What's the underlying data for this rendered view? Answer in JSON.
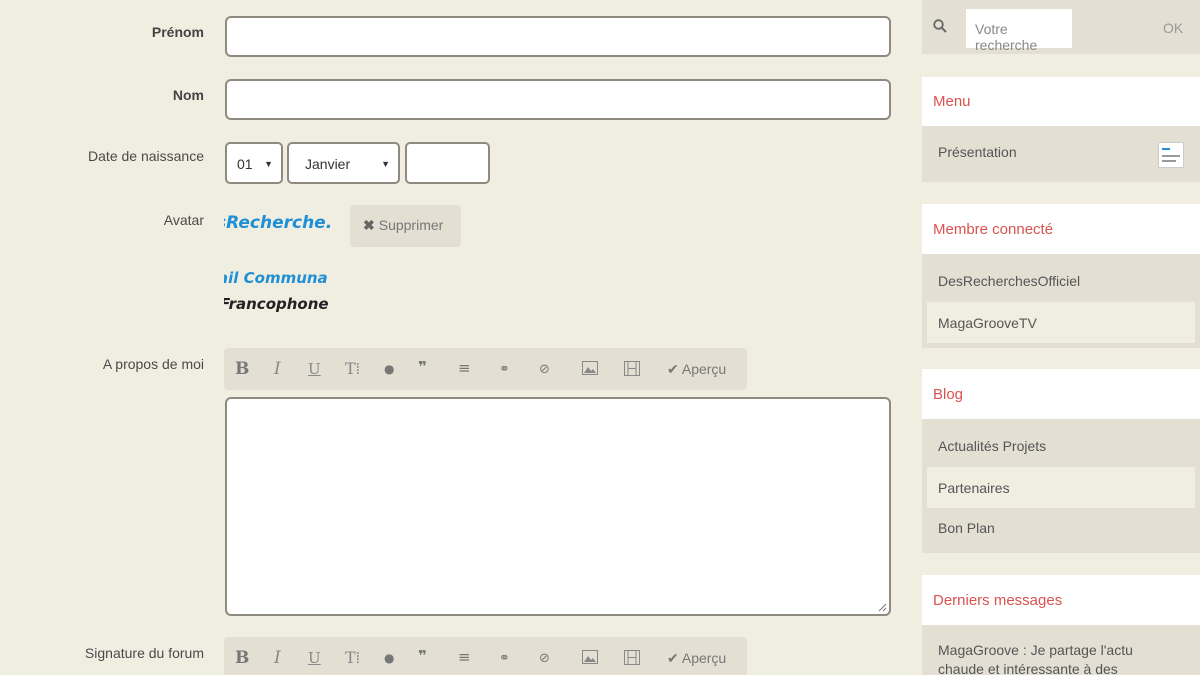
{
  "form": {
    "firstname_label": "Prénom",
    "lastname_label": "Nom",
    "birthdate_label": "Date de naissance",
    "day_value": "01",
    "month_value": "Janvier",
    "avatar_label": "Avatar",
    "delete_label": "Supprimer",
    "about_label": "A propos de moi",
    "signature_label": "Signature du forum",
    "preview_label": "Aperçu"
  },
  "avatar": {
    "line1": "sRecherche.",
    "line2": "ail Communa",
    "line3": "Francophone"
  },
  "editor_icons": [
    "bold-icon",
    "italic-icon",
    "underline-icon",
    "text-size-icon",
    "color-drop-icon",
    "quote-icon",
    "align-center-icon",
    "link-icon",
    "spoiler-icon",
    "image-icon",
    "video-icon",
    "check-icon"
  ],
  "sidebar": {
    "search_placeholder": "Votre recherche",
    "search_ok": "OK",
    "menu_title": "Menu",
    "menu_item": "Présentation",
    "member_title": "Membre connecté",
    "members": [
      "DesRecherchesOfficiel",
      "MagaGrooveTV"
    ],
    "blog_title": "Blog",
    "blog_items": [
      "Actualités Projets",
      "Partenaires",
      "Bon Plan"
    ],
    "last_title": "Derniers messages",
    "last_message": "MagaGroove : Je partage l'actu chaude et intéressante à des"
  },
  "colors": {
    "background": "#f0eee1",
    "panel": "#e3e0d3",
    "accent": "#d9534f",
    "border": "#8f8a80"
  }
}
